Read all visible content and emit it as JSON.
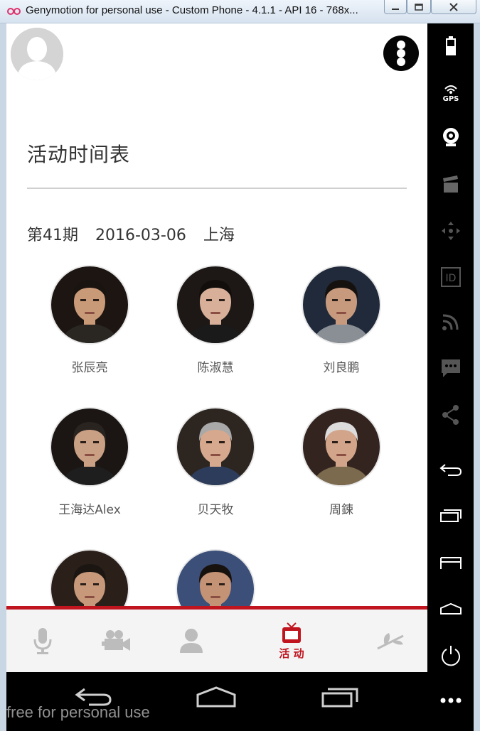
{
  "window": {
    "title": "Genymotion for personal use - Custom Phone - 4.1.1 - API 16 - 768x..."
  },
  "page": {
    "title": "活动时间表",
    "event": {
      "issue": "第41期",
      "date": "2016-03-06",
      "city": "上海"
    }
  },
  "speakers": [
    {
      "name": "张辰亮",
      "skin": "#c99a78",
      "hair": "#1a1410",
      "bg": "#1c1512",
      "shirt": "#2a2622"
    },
    {
      "name": "陈淑慧",
      "skin": "#d8b09a",
      "hair": "#120e0c",
      "bg": "#1d1816",
      "shirt": "#1a1a1a"
    },
    {
      "name": "刘良鹏",
      "skin": "#c79a7e",
      "hair": "#15110e",
      "bg": "#202a3a",
      "shirt": "#8a8f96"
    },
    {
      "name": "王海达Alex",
      "skin": "#caa084",
      "hair": "#2a2420",
      "bg": "#1b1614",
      "shirt": "#1e1e1e"
    },
    {
      "name": "贝天牧",
      "skin": "#d6a88e",
      "hair": "#a9a9a9",
      "bg": "#2c2520",
      "shirt": "#2c3c5a"
    },
    {
      "name": "周鋉",
      "skin": "#d2a58a",
      "hair": "#dcdcdc",
      "bg": "#33241f",
      "shirt": "#7c6a4e"
    },
    {
      "name": "",
      "skin": "#c8987a",
      "hair": "#1b1612",
      "bg": "#2b1f1a",
      "shirt": "#2a2a2a"
    },
    {
      "name": "",
      "skin": "#c49274",
      "hair": "#18120e",
      "bg": "#3b4f78",
      "shirt": "#2a2a2a"
    }
  ],
  "tabs": [
    {
      "id": "mic",
      "icon": "microphone-icon",
      "label": ""
    },
    {
      "id": "video",
      "icon": "video-camera-icon",
      "label": ""
    },
    {
      "id": "person",
      "icon": "person-icon",
      "label": ""
    },
    {
      "id": "events",
      "icon": "tv-icon",
      "label": "活 动",
      "active": true
    },
    {
      "id": "more",
      "icon": "plant-icon",
      "label": ""
    }
  ],
  "sidebar": {
    "icons": [
      "battery-icon",
      "gps-icon",
      "webcam-icon",
      "clapperboard-icon",
      "dpad-icon",
      "id-icon",
      "rss-icon",
      "sms-icon",
      "share-icon",
      "back-icon",
      "recent-apps-icon",
      "menu-icon",
      "home-icon",
      "power-icon",
      "more-icon"
    ],
    "gps_label": "GPS",
    "id_label": "ID"
  },
  "watermark": "free for personal use",
  "colors": {
    "accent": "#c0141f",
    "tab_inactive": "#bcbcbc"
  }
}
